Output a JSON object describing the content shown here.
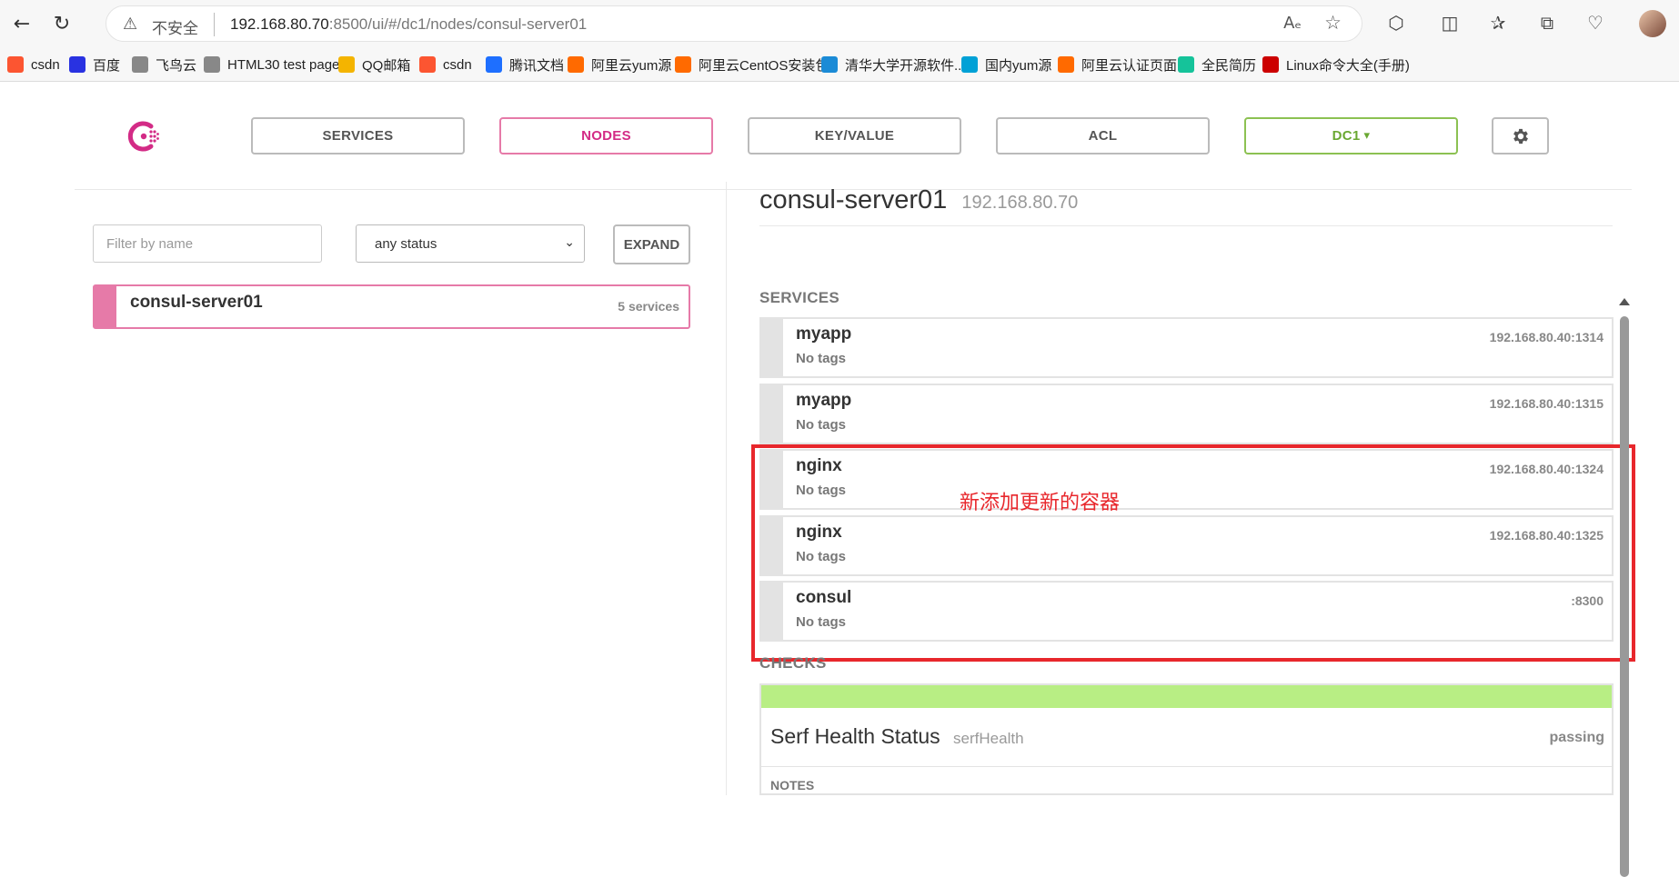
{
  "browser": {
    "insecure_label": "不安全",
    "url_host": "192.168.80.70",
    "url_rest": ":8500/ui/#/dc1/nodes/consul-server01",
    "read_aloud_label": "Aₑ"
  },
  "bookmarks": [
    {
      "label": "csdn",
      "color": "#fc5531"
    },
    {
      "label": "百度",
      "color": "#2932e1"
    },
    {
      "label": "飞鸟云",
      "color": "#888888"
    },
    {
      "label": "HTML30 test page!",
      "color": "#888888"
    },
    {
      "label": "QQ邮箱",
      "color": "#f4b400"
    },
    {
      "label": "csdn",
      "color": "#fc5531"
    },
    {
      "label": "腾讯文档",
      "color": "#1e6fff"
    },
    {
      "label": "阿里云yum源",
      "color": "#ff6a00"
    },
    {
      "label": "阿里云CentOS安装包",
      "color": "#ff6a00"
    },
    {
      "label": "清华大学开源软件...",
      "color": "#1b8bd6"
    },
    {
      "label": "国内yum源",
      "color": "#00a1d6"
    },
    {
      "label": "阿里云认证页面",
      "color": "#ff6a00"
    },
    {
      "label": "全民简历",
      "color": "#15c39a"
    },
    {
      "label": "Linux命令大全(手册)",
      "color": "#cc0000"
    }
  ],
  "nav": {
    "services": "SERVICES",
    "nodes": "NODES",
    "keyvalue": "KEY/VALUE",
    "acl": "ACL",
    "dc": "DC1",
    "dc_caret": "▾"
  },
  "filters": {
    "name_placeholder": "Filter by name",
    "status_value": "any status",
    "expand_label": "EXPAND"
  },
  "node_list": [
    {
      "name": "consul-server01",
      "services_count": "5 services"
    }
  ],
  "node_detail": {
    "name": "consul-server01",
    "ip": "192.168.80.70",
    "services_heading": "SERVICES",
    "services": [
      {
        "name": "myapp",
        "tags": "No tags",
        "address": "192.168.80.40:1314"
      },
      {
        "name": "myapp",
        "tags": "No tags",
        "address": "192.168.80.40:1315"
      },
      {
        "name": "nginx",
        "tags": "No tags",
        "address": "192.168.80.40:1324"
      },
      {
        "name": "nginx",
        "tags": "No tags",
        "address": "192.168.80.40:1325"
      },
      {
        "name": "consul",
        "tags": "No tags",
        "address": ":8300"
      }
    ],
    "checks_heading": "CHECKS",
    "checks": [
      {
        "name": "Serf Health Status",
        "id": "serfHealth",
        "status": "passing",
        "notes_label": "NOTES"
      }
    ]
  },
  "annotation": {
    "text": "新添加更新的容器",
    "color": "#e8272c"
  },
  "colors": {
    "brand": "#d32b86",
    "node_accent": "#e67aa8",
    "dc_green": "#8cc152",
    "passing": "#b8ee84"
  }
}
